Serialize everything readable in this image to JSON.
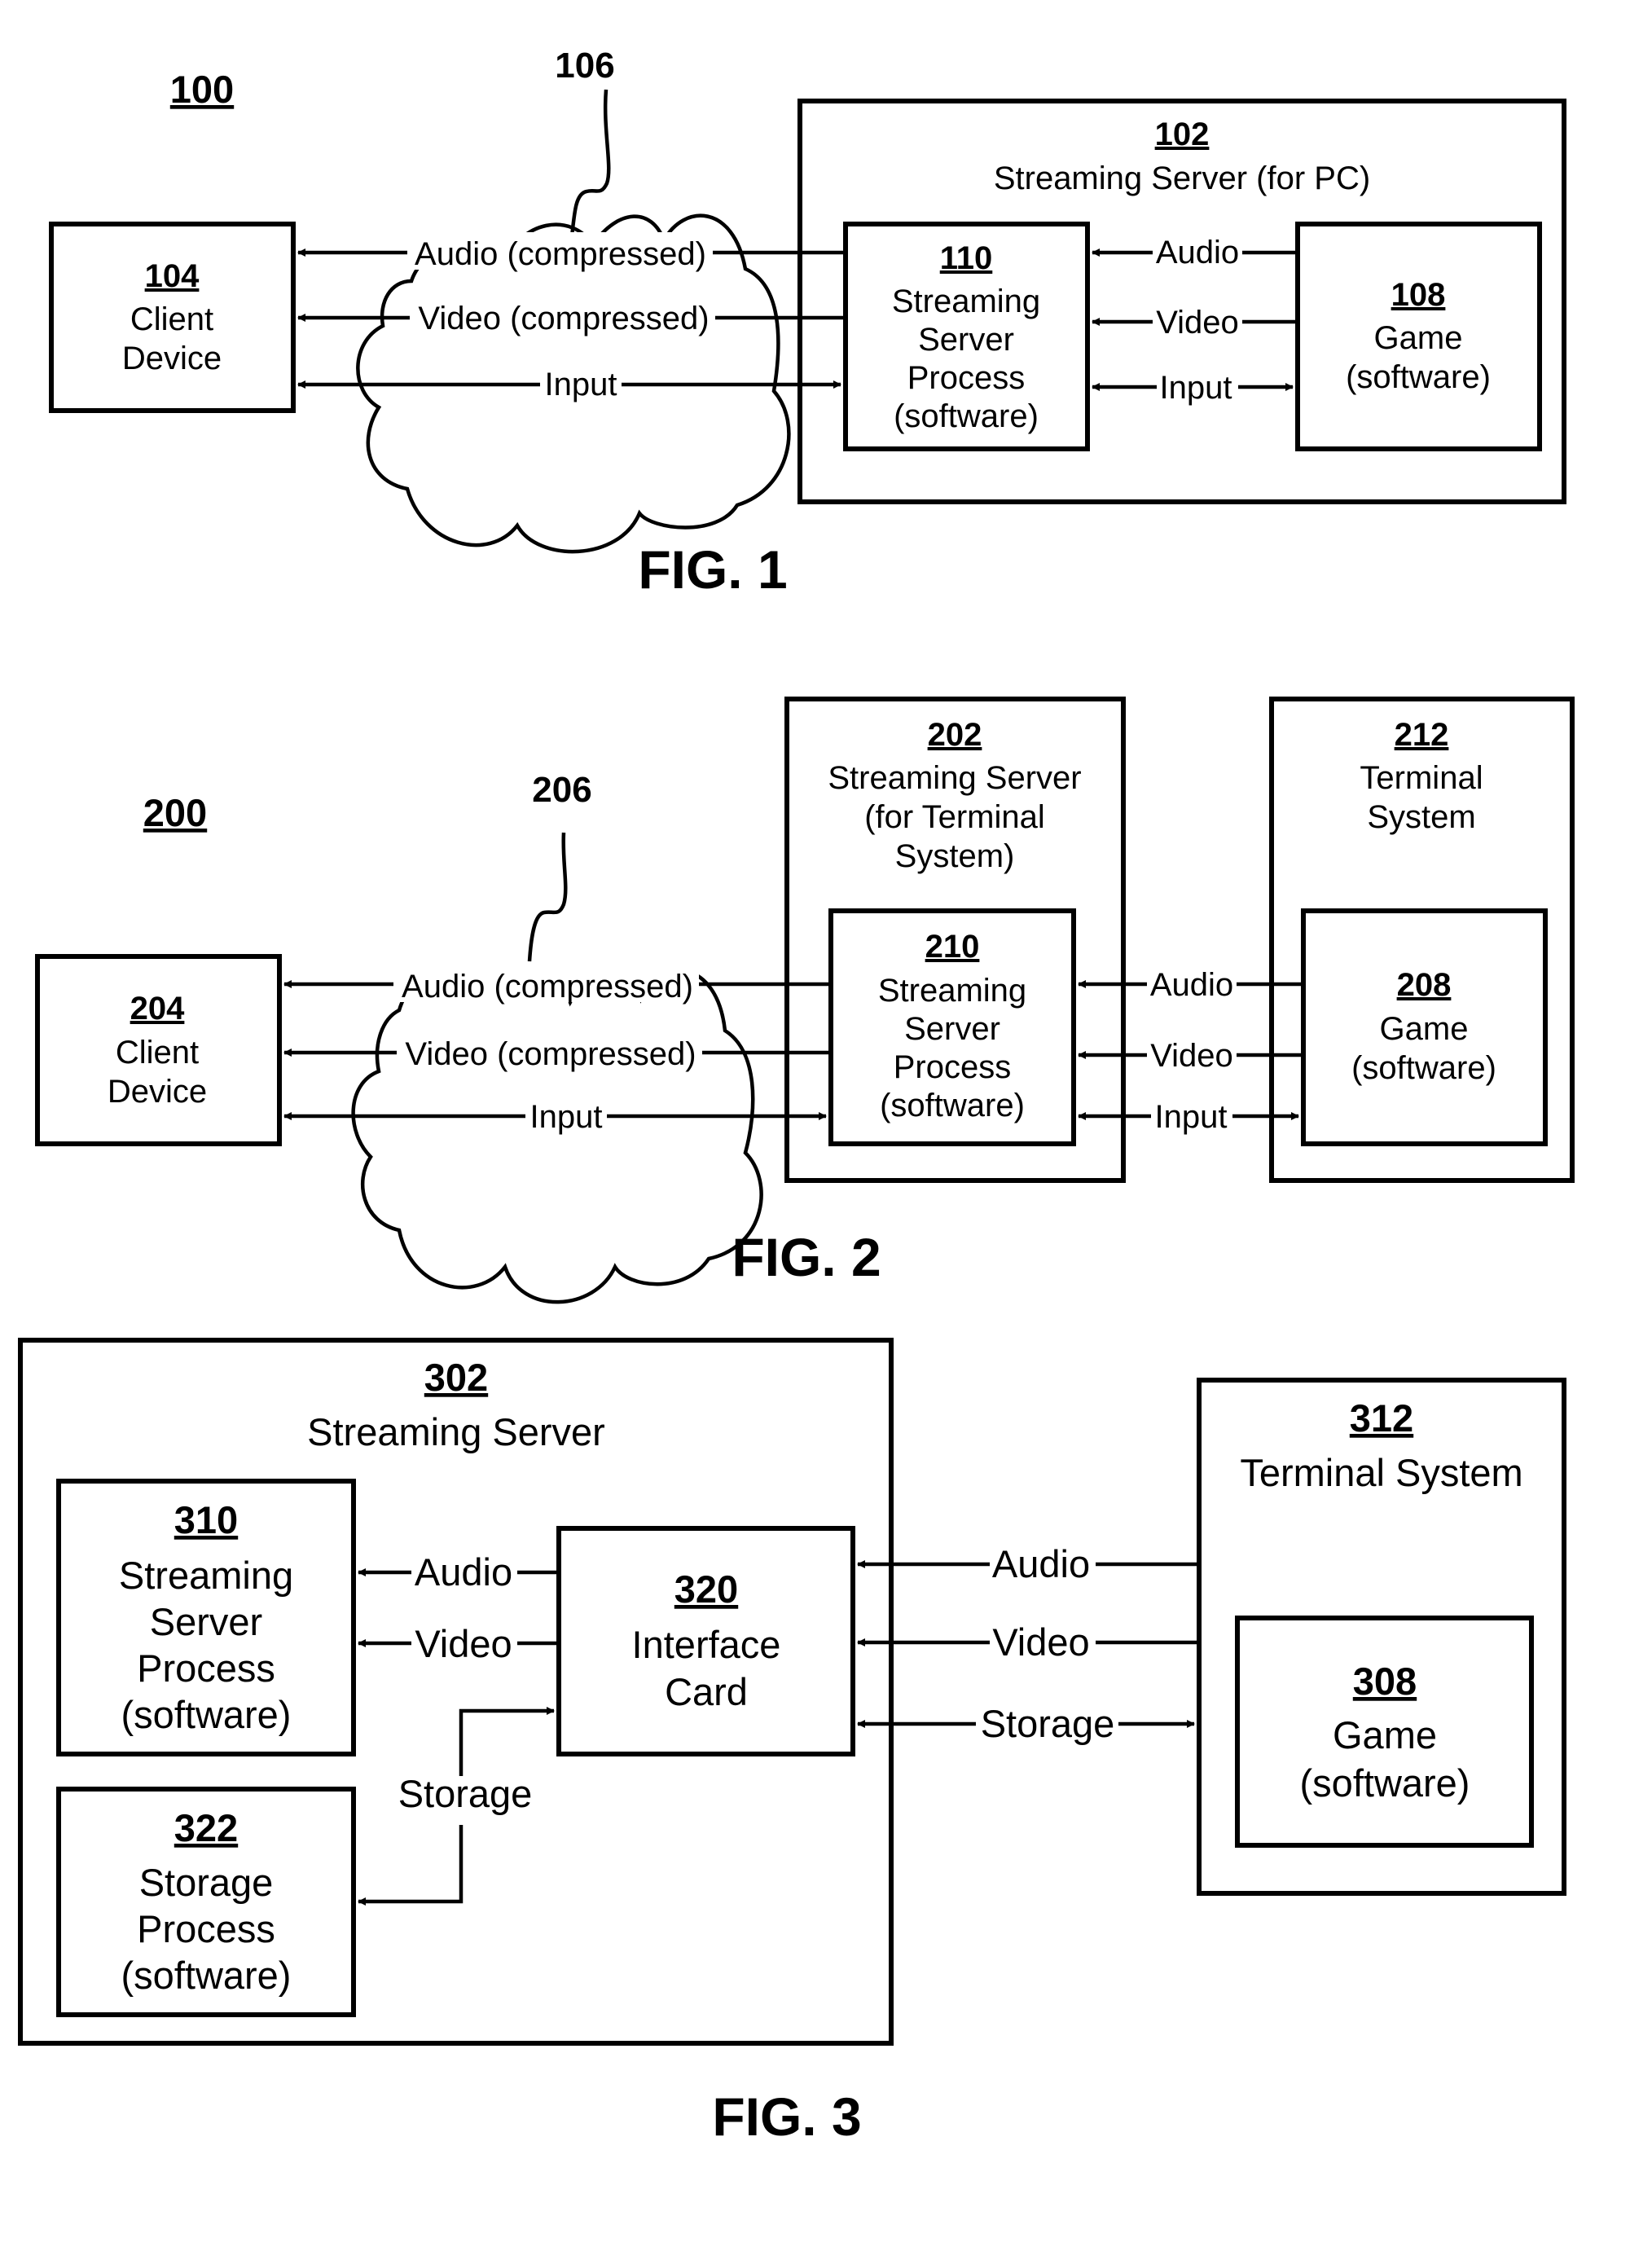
{
  "fig1": {
    "caption": "FIG. 1",
    "system_ref": "100",
    "network_ref": "106",
    "client": {
      "ref": "104",
      "lines": [
        "Client",
        "Device"
      ]
    },
    "server": {
      "ref": "102",
      "title": "Streaming Server (for PC)"
    },
    "process": {
      "ref": "110",
      "lines": [
        "Streaming",
        "Server",
        "Process",
        "(software)"
      ]
    },
    "game": {
      "ref": "108",
      "lines": [
        "Game",
        "(software)"
      ]
    },
    "network_links": [
      "Audio (compressed)",
      "Video (compressed)",
      "Input"
    ],
    "internal_links": [
      "Audio",
      "Video",
      "Input"
    ]
  },
  "fig2": {
    "caption": "FIG. 2",
    "system_ref": "200",
    "network_ref": "206",
    "client": {
      "ref": "204",
      "lines": [
        "Client",
        "Device"
      ]
    },
    "server": {
      "ref": "202",
      "lines": [
        "Streaming Server",
        "(for Terminal",
        "System)"
      ]
    },
    "process": {
      "ref": "210",
      "lines": [
        "Streaming",
        "Server",
        "Process",
        "(software)"
      ]
    },
    "terminal": {
      "ref": "212",
      "lines": [
        "Terminal",
        "System"
      ]
    },
    "game": {
      "ref": "208",
      "lines": [
        "Game",
        "(software)"
      ]
    },
    "network_links": [
      "Audio (compressed)",
      "Video (compressed)",
      "Input"
    ],
    "internal_links": [
      "Audio",
      "Video",
      "Input"
    ]
  },
  "fig3": {
    "caption": "FIG. 3",
    "server": {
      "ref": "302",
      "title": "Streaming Server"
    },
    "process": {
      "ref": "310",
      "lines": [
        "Streaming",
        "Server",
        "Process",
        "(software)"
      ]
    },
    "storage_process": {
      "ref": "322",
      "lines": [
        "Storage",
        "Process",
        "(software)"
      ]
    },
    "interface": {
      "ref": "320",
      "lines": [
        "Interface",
        "Card"
      ]
    },
    "terminal": {
      "ref": "312",
      "title": "Terminal System"
    },
    "game": {
      "ref": "308",
      "lines": [
        "Game",
        "(software)"
      ]
    },
    "internal_links": [
      "Audio",
      "Video",
      "Storage"
    ],
    "external_links": [
      "Audio",
      "Video",
      "Storage"
    ]
  }
}
